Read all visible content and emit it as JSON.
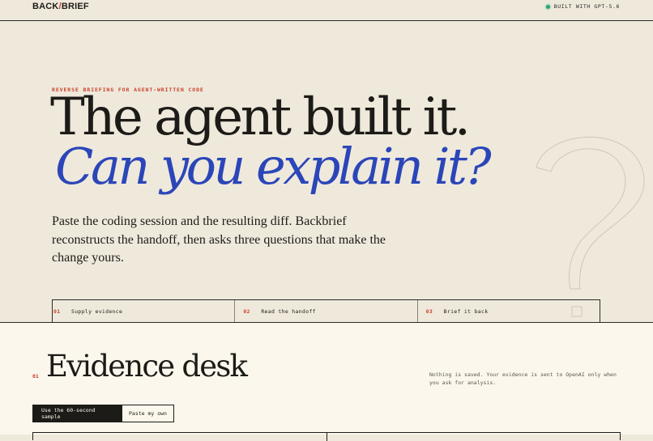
{
  "header": {
    "logo_left": "BACK",
    "logo_slash": "/",
    "logo_right": "BRIEF",
    "status": "BUILT WITH GPT-5.6"
  },
  "hero": {
    "kicker": "REVERSE BRIEFING FOR AGENT-WRITTEN CODE",
    "headline_line1": "The agent built it.",
    "headline_line2": "Can you explain it?",
    "lede": "Paste the coding session and the resulting diff. Backbrief reconstructs the handoff, then asks three questions that make the change yours.",
    "steps": [
      {
        "num": "01",
        "label": "Supply evidence"
      },
      {
        "num": "02",
        "label": "Read the handoff"
      },
      {
        "num": "03",
        "label": "Brief it back"
      }
    ]
  },
  "evidence": {
    "number": "01",
    "title": "Evidence desk",
    "note": "Nothing is saved. Your evidence is sent to OpenAI only when you ask for analysis.",
    "tabs": [
      {
        "label": "Use the 60-second sample",
        "active": true
      },
      {
        "label": "Paste my own",
        "active": false
      }
    ]
  },
  "colors": {
    "accent_red": "#c9432c",
    "accent_blue": "#2b46b8",
    "status_green": "#2fa36b",
    "ink": "#1c1b17",
    "paper": "#efe9dc"
  }
}
